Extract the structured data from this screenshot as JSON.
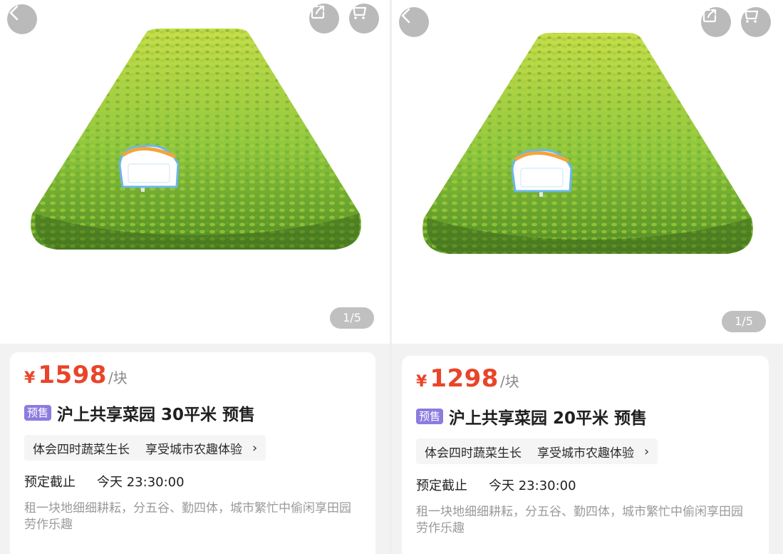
{
  "colors": {
    "price": "#e8452a",
    "badge": "#8d7bdf",
    "grass": "#8cc63f"
  },
  "left": {
    "image_counter": "1/5",
    "icons": {
      "back": "back-chevron-icon",
      "share": "share-icon",
      "cart": "cart-icon"
    },
    "yen": "¥",
    "price": "1598",
    "unit": "/块",
    "badge": "预售",
    "title": "沪上共享菜园 30平米 预售",
    "tag1": "体会四时蔬菜生长",
    "tag2": "享受城市农趣体验",
    "chevron": "›",
    "deadline_label": "预定截止",
    "deadline_value": "今天 23:30:00",
    "description": "租一块地细细耕耘，分五谷、勤四体，城市繁忙中偷闲享田园劳作乐趣"
  },
  "right": {
    "image_counter": "1/5",
    "icons": {
      "back": "back-chevron-icon",
      "share": "share-icon",
      "cart": "cart-icon"
    },
    "yen": "¥",
    "price": "1298",
    "unit": "/块",
    "badge": "预售",
    "title": "沪上共享菜园 20平米 预售",
    "tag1": "体会四时蔬菜生长",
    "tag2": "享受城市农趣体验",
    "chevron": "›",
    "deadline_label": "预定截止",
    "deadline_value": "今天 23:30:00",
    "description": "租一块地细细耕耘，分五谷、勤四体，城市繁忙中偷闲享田园劳作乐趣"
  }
}
